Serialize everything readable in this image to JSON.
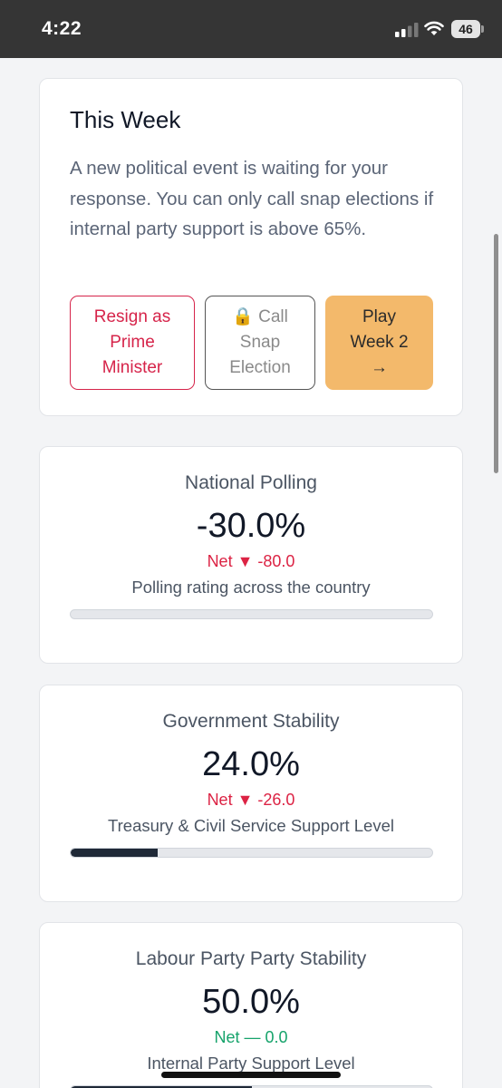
{
  "status_bar": {
    "time": "4:22",
    "battery": "46"
  },
  "this_week": {
    "title": "This Week",
    "description": "A new political event is waiting for your response. You can only call snap elections if internal party support is above 65%.",
    "buttons": {
      "resign": "Resign as\nPrime\nMinister",
      "snap": "🔒 Call\nSnap\nElection",
      "play": "Play\nWeek 2\n→"
    }
  },
  "stats": [
    {
      "title": "National Polling",
      "value": "-30.0%",
      "net": "Net ▼ -80.0",
      "net_direction": "down",
      "subtitle": "Polling rating across the country",
      "progress": 0
    },
    {
      "title": "Government Stability",
      "value": "24.0%",
      "net": "Net ▼ -26.0",
      "net_direction": "down",
      "subtitle": "Treasury & Civil Service Support Level",
      "progress": 0.24
    },
    {
      "title": "Labour Party Party Stability",
      "value": "50.0%",
      "net": "Net — 0.0",
      "net_direction": "flat",
      "subtitle": "Internal Party Support Level",
      "progress": 0.5
    }
  ],
  "colors": {
    "negative": "#dc2344",
    "neutral": "#16a36b",
    "accent": "#f3b96b"
  }
}
